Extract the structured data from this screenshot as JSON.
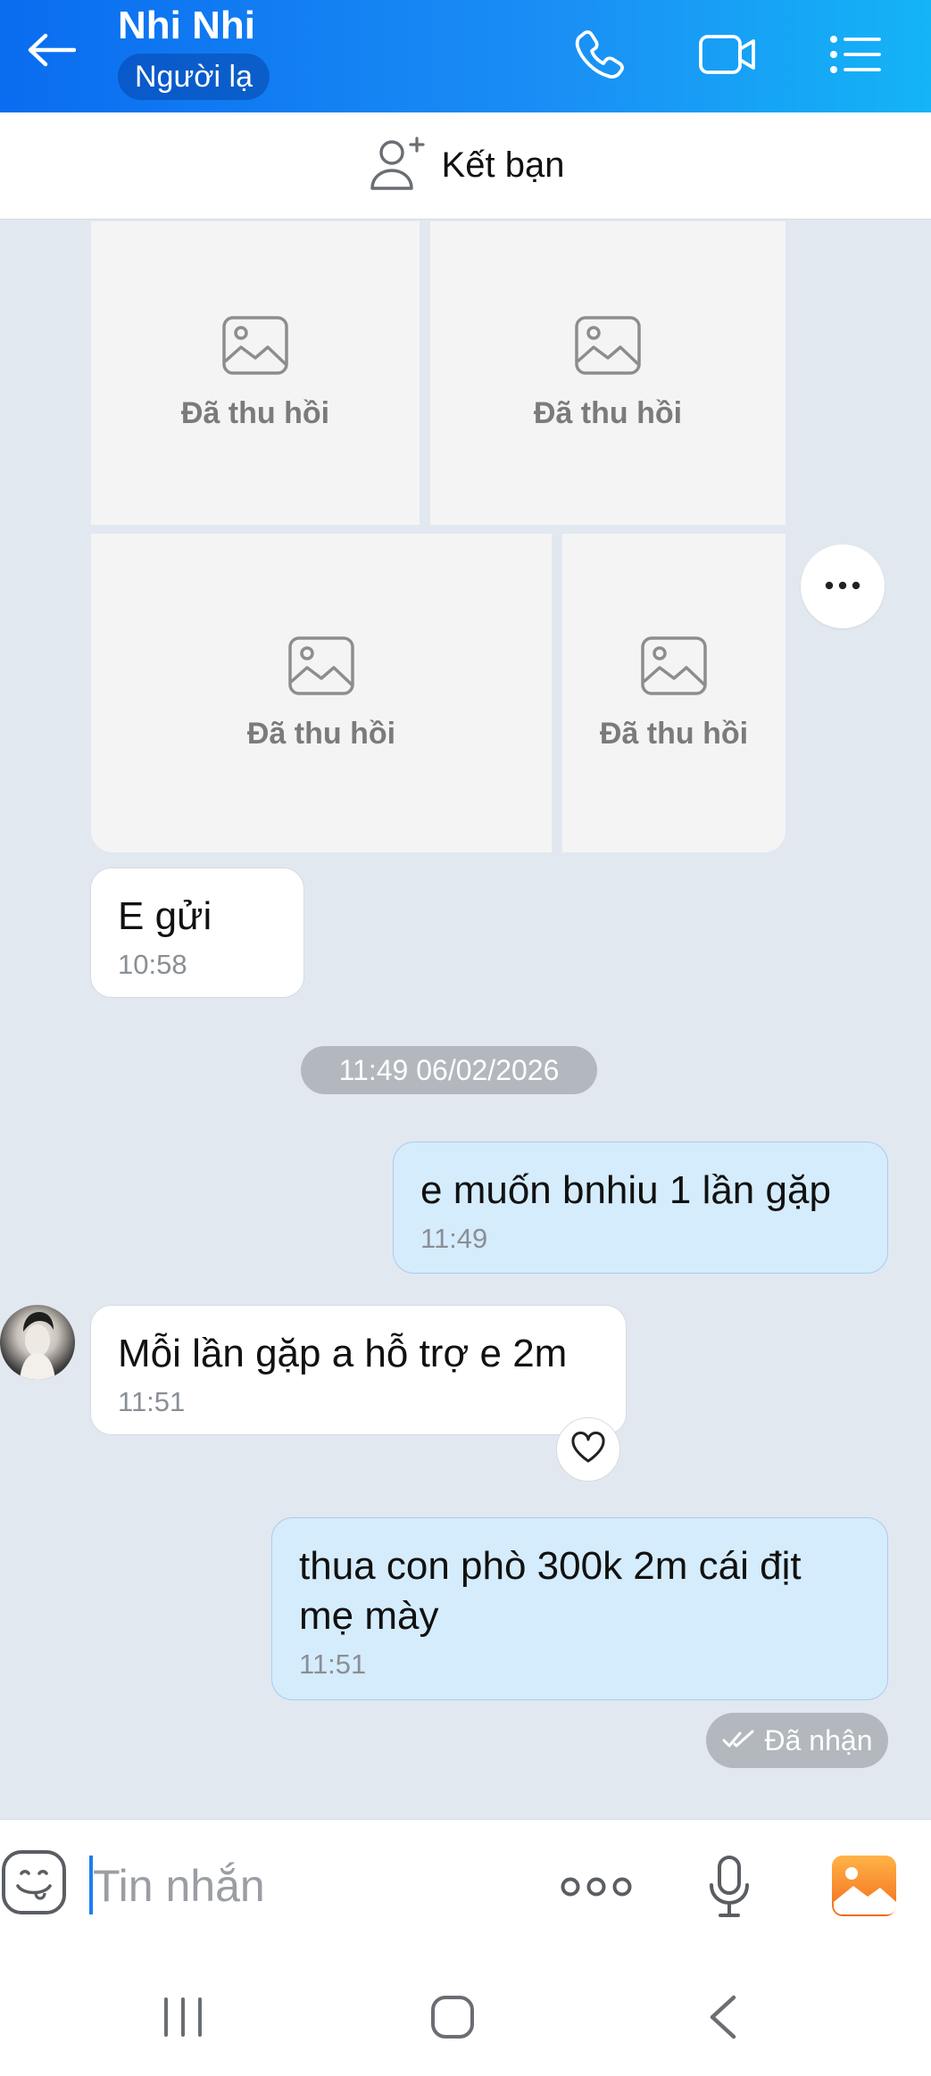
{
  "header": {
    "title": "Nhi Nhi",
    "badge": "Người lạ",
    "icons": [
      "back-arrow-icon",
      "phone-icon",
      "video-call-icon",
      "menu-list-icon"
    ]
  },
  "friend_bar": {
    "label": "Kết bạn",
    "icon": "add-friend-icon"
  },
  "recalled_tiles": [
    {
      "label": "Đã thu hồi"
    },
    {
      "label": "Đã thu hồi"
    },
    {
      "label": "Đã thu hồi"
    },
    {
      "label": "Đã thu hồi"
    }
  ],
  "messages": [
    {
      "direction": "incoming",
      "text": "E gửi",
      "time": "10:58"
    },
    {
      "direction": "outgoing",
      "text": "e muốn bnhiu 1 lần gặp",
      "time": "11:49"
    },
    {
      "direction": "incoming",
      "text": "Mỗi lần gặp a hỗ trợ e 2m",
      "time": "11:51"
    },
    {
      "direction": "outgoing",
      "text": "thua con phò 300k 2m cái địt mẹ mày",
      "time": "11:51"
    }
  ],
  "date_separator": "11:49 06/02/2026",
  "delivery_status": "Đã nhận",
  "input": {
    "placeholder": "Tin nhắn",
    "value": ""
  },
  "colors": {
    "header_start": "#0a6cf0",
    "header_end": "#14b4f6",
    "outgoing_bubble": "#d5ecfc",
    "background": "#e2e8f0"
  }
}
